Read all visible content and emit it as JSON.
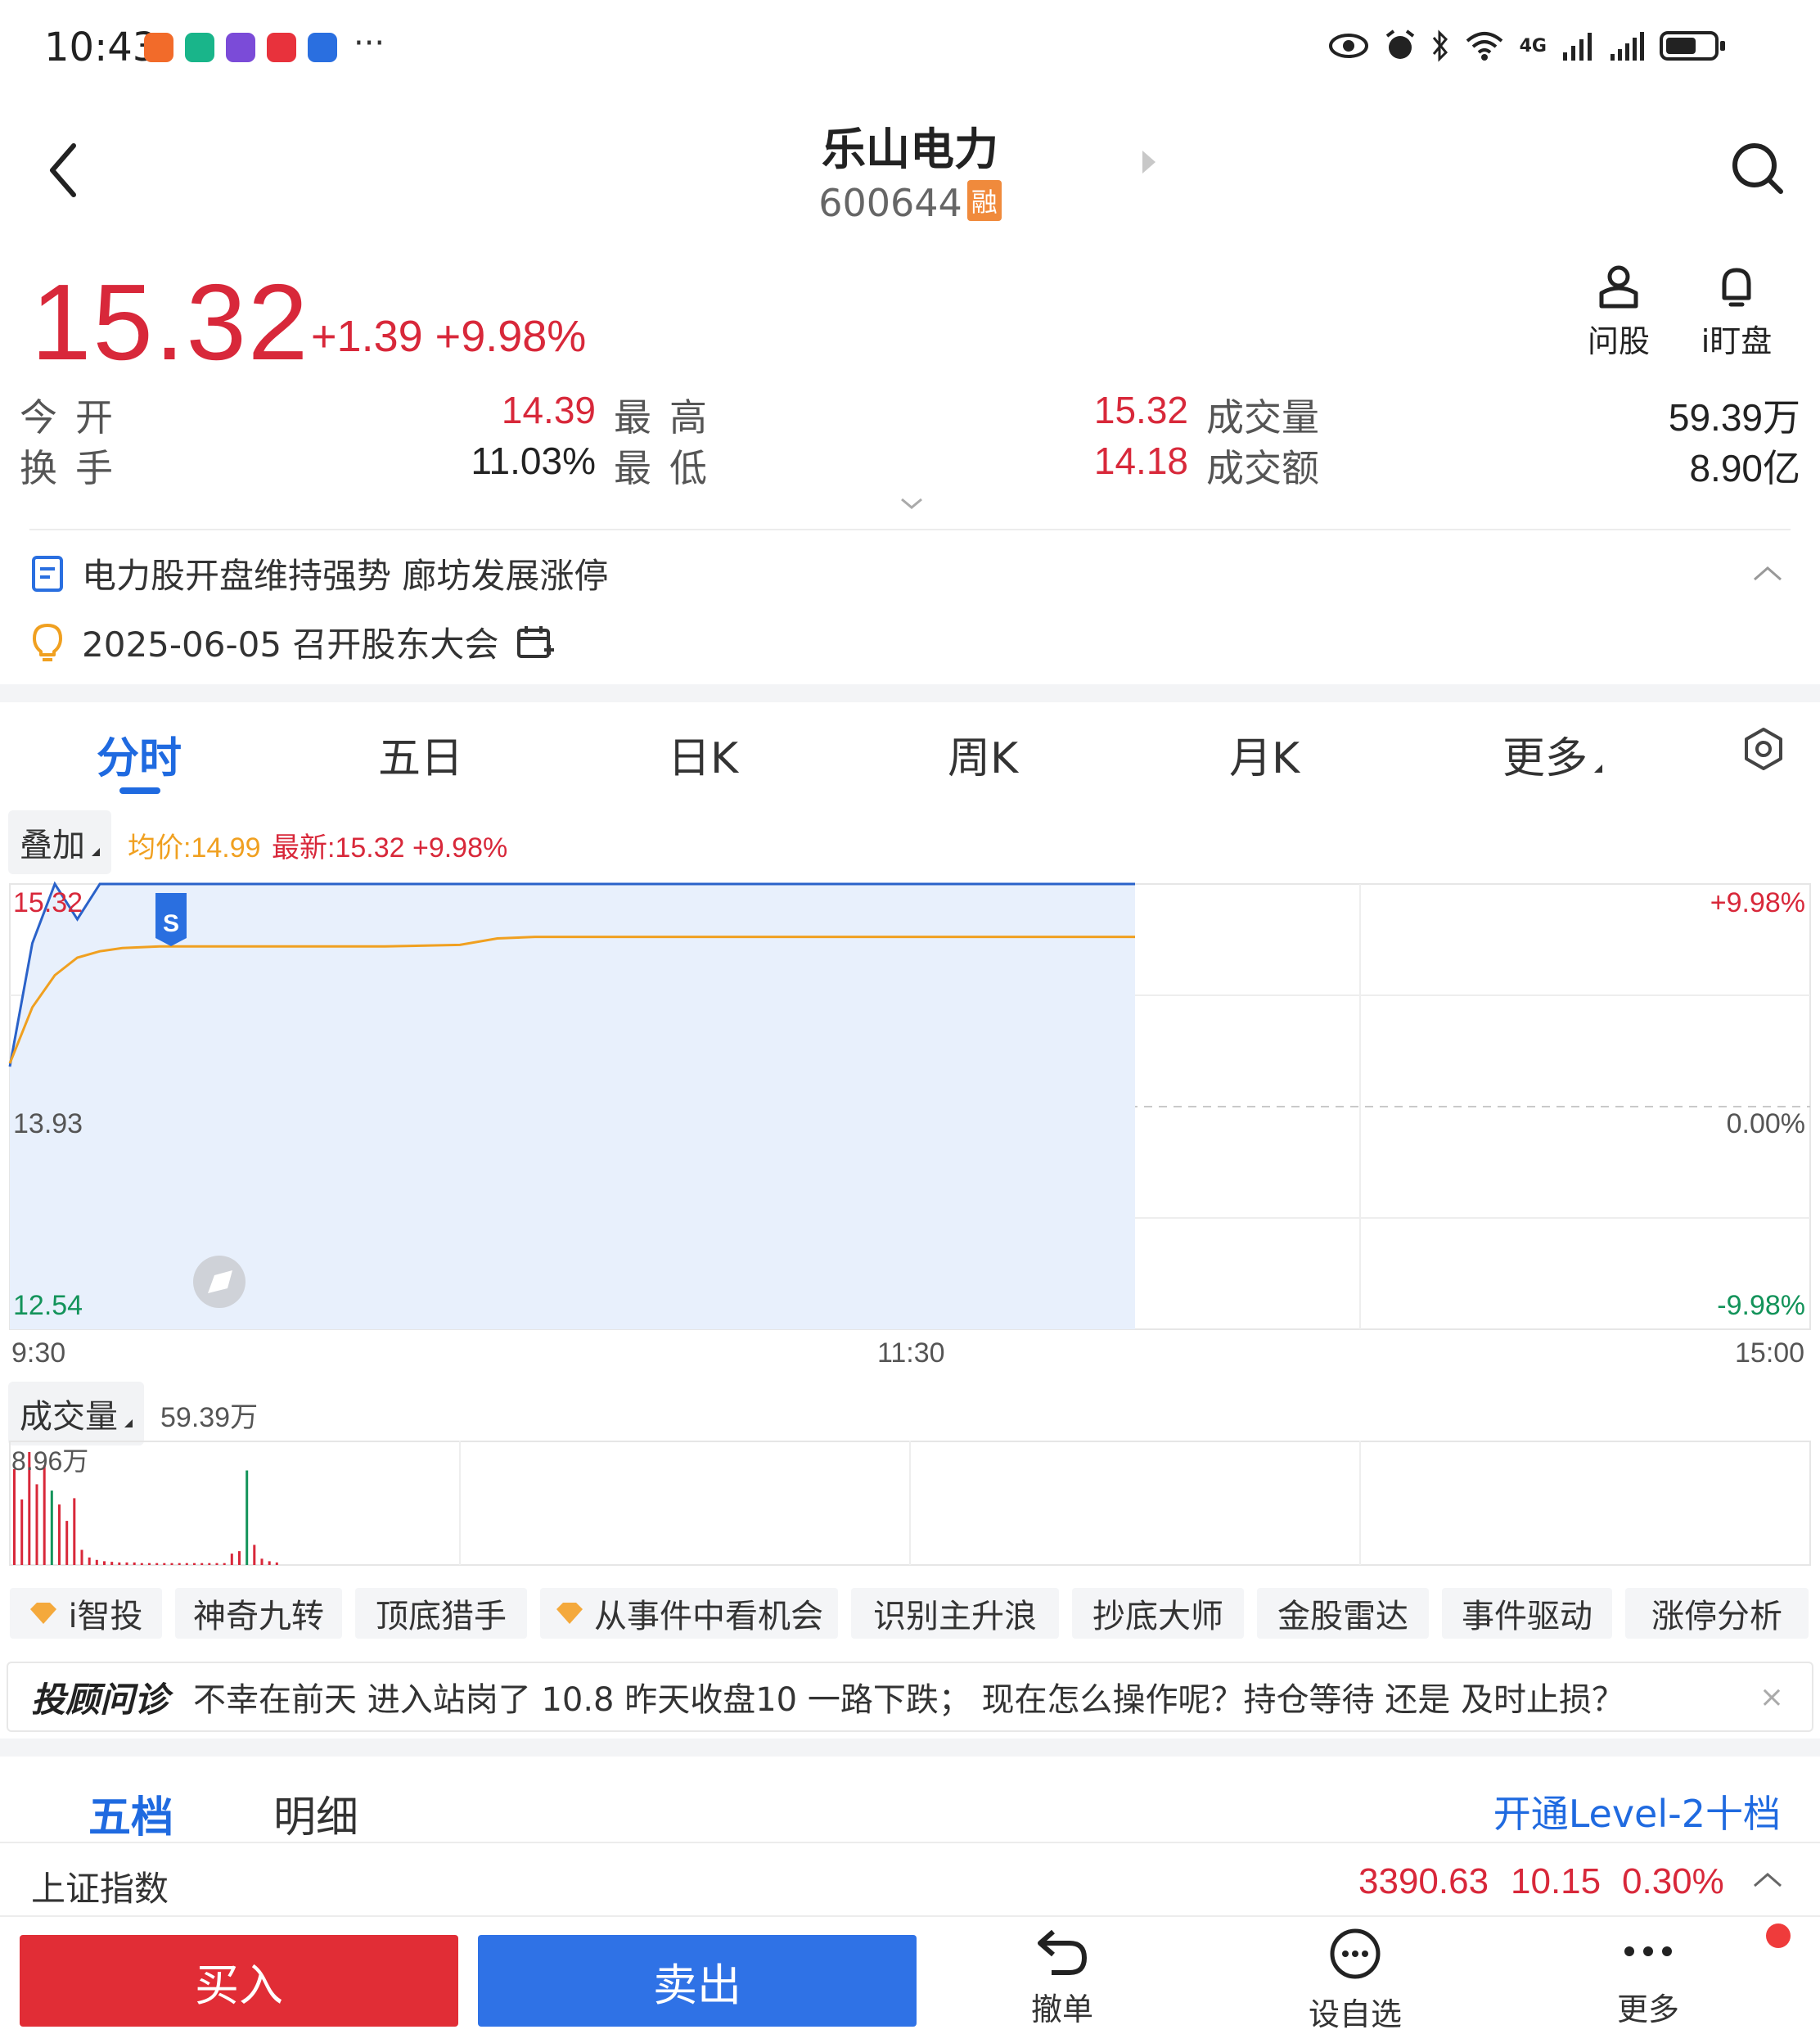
{
  "status_bar": {
    "time": "10:43",
    "overflow": "···",
    "network": "4G",
    "app_colors": [
      "#f26b2a",
      "#19b58a",
      "#7b4bd8",
      "#e8323c",
      "#2a6fe0"
    ]
  },
  "header": {
    "title": "乐山电力",
    "code": "600644",
    "margin_badge": "融"
  },
  "quote": {
    "price": "15.32",
    "change": "+1.39",
    "change_pct": "+9.98%",
    "tools": [
      {
        "icon": "person-ask-icon",
        "label": "问股"
      },
      {
        "icon": "bell-icon",
        "label": "i盯盘"
      }
    ],
    "stats": {
      "open_label": "今开",
      "open": "14.39",
      "high_label": "最高",
      "high": "15.32",
      "volume_label": "成交量",
      "volume": "59.39万",
      "turnover_label": "换手",
      "turnover": "11.03%",
      "low_label": "最低",
      "low": "14.18",
      "amount_label": "成交额",
      "amount": "8.90亿"
    }
  },
  "news": {
    "headline": "电力股开盘维持强势 廊坊发展涨停",
    "event": "2025-06-05 召开股东大会"
  },
  "chart_tabs": [
    "分时",
    "五日",
    "日K",
    "周K",
    "月K",
    "更多"
  ],
  "chart_tab_active": 0,
  "intraday": {
    "overlay_label": "叠加",
    "avg_label": "均价:14.99",
    "latest_label": "最新:15.32 +9.98%",
    "marker": "S",
    "price_axis": [
      "15.32",
      "13.93",
      "12.54"
    ],
    "pct_axis": [
      "+9.98%",
      "0.00%",
      "-9.98%"
    ],
    "time_axis": [
      "9:30",
      "11:30",
      "15:00"
    ],
    "volume_label": "成交量",
    "volume_total": "59.39万",
    "volume_max": "8.96万"
  },
  "chart_data": {
    "type": "line",
    "title": "",
    "x": [
      "9:30",
      "9:33",
      "9:36",
      "9:39",
      "9:42",
      "9:45",
      "9:50",
      "10:00",
      "10:10",
      "10:20",
      "10:30",
      "10:35",
      "10:40",
      "10:50",
      "11:00",
      "11:10",
      "11:20",
      "11:30",
      "11:31",
      "13:00",
      "13:05",
      "13:10",
      "13:15",
      "13:20",
      "13:30"
    ],
    "series": [
      {
        "name": "最新",
        "values": [
          14.18,
          14.95,
          15.32,
          15.1,
          15.32,
          15.32,
          15.32,
          15.32,
          15.32,
          15.32,
          15.32,
          15.32,
          15.32,
          15.32,
          15.32,
          15.32,
          15.32,
          15.32,
          15.32,
          15.32,
          15.32,
          15.32,
          15.32,
          15.32,
          15.32
        ]
      },
      {
        "name": "均价",
        "values": [
          14.2,
          14.55,
          14.75,
          14.86,
          14.9,
          14.92,
          14.93,
          14.93,
          14.93,
          14.93,
          14.94,
          14.98,
          14.99,
          14.99,
          14.99,
          14.99,
          14.99,
          14.99,
          14.99,
          14.99,
          14.99,
          14.99,
          14.99,
          14.99,
          14.99
        ]
      }
    ],
    "xlim": [
      "9:30",
      "15:00"
    ],
    "ylim": [
      12.54,
      15.32
    ],
    "y_reference": 13.93,
    "volume_bars": [
      {
        "v": 7.6,
        "c": "red"
      },
      {
        "v": 5.2,
        "c": "red"
      },
      {
        "v": 8.96,
        "c": "red"
      },
      {
        "v": 6.4,
        "c": "red"
      },
      {
        "v": 7.9,
        "c": "red"
      },
      {
        "v": 5.9,
        "c": "green"
      },
      {
        "v": 4.8,
        "c": "red"
      },
      {
        "v": 3.5,
        "c": "red"
      },
      {
        "v": 5.3,
        "c": "red"
      },
      {
        "v": 1.2,
        "c": "red"
      },
      {
        "v": 0.6,
        "c": "red"
      },
      {
        "v": 0.4,
        "c": "red"
      },
      {
        "v": 0.3,
        "c": "red"
      },
      {
        "v": 0.25,
        "c": "red"
      },
      {
        "v": 0.2,
        "c": "red"
      },
      {
        "v": 0.2,
        "c": "red"
      },
      {
        "v": 0.2,
        "c": "red"
      },
      {
        "v": 0.15,
        "c": "red"
      },
      {
        "v": 0.15,
        "c": "red"
      },
      {
        "v": 0.15,
        "c": "red"
      },
      {
        "v": 0.15,
        "c": "red"
      },
      {
        "v": 0.15,
        "c": "red"
      },
      {
        "v": 0.15,
        "c": "red"
      },
      {
        "v": 0.15,
        "c": "red"
      },
      {
        "v": 0.15,
        "c": "red"
      },
      {
        "v": 0.15,
        "c": "red"
      },
      {
        "v": 0.15,
        "c": "red"
      },
      {
        "v": 0.15,
        "c": "red"
      },
      {
        "v": 0.15,
        "c": "red"
      },
      {
        "v": 0.9,
        "c": "red"
      },
      {
        "v": 1.1,
        "c": "red"
      },
      {
        "v": 7.5,
        "c": "green"
      },
      {
        "v": 1.6,
        "c": "red"
      },
      {
        "v": 0.5,
        "c": "red"
      },
      {
        "v": 0.3,
        "c": "red"
      },
      {
        "v": 0.2,
        "c": "red"
      }
    ],
    "volume_ylim": [
      0,
      8.96
    ],
    "colors": {
      "price": "#2a62c9",
      "avg": "#f0a020",
      "up": "#d8283a",
      "down": "#13935a",
      "fill": "#e8f0fc"
    }
  },
  "features": [
    "i智投",
    "神奇九转",
    "顶底猎手",
    "从事件中看机会",
    "识别主升浪",
    "抄底大师",
    "金股雷达",
    "事件驱动",
    "涨停分析"
  ],
  "banner": {
    "tag": "投顾问诊",
    "text": "不幸在前天 进入站岗了 10.8 昨天收盘10 一路下跌； 现在怎么操作呢？持仓等待 还是 及时止损？",
    "close": "×"
  },
  "order_book": {
    "tabs": [
      "五档",
      "明细"
    ],
    "upgrade_link": "开通Level-2十档"
  },
  "index_row": {
    "name": "上证指数",
    "value": "3390.63",
    "change": "10.15",
    "change_pct": "0.30%"
  },
  "bottom_bar": {
    "buy": "买入",
    "sell": "卖出",
    "actions": [
      {
        "icon": "undo-icon",
        "label": "撤单"
      },
      {
        "icon": "chat-dots-icon",
        "label": "设自选"
      },
      {
        "icon": "more-dots-icon",
        "label": "更多"
      }
    ]
  }
}
